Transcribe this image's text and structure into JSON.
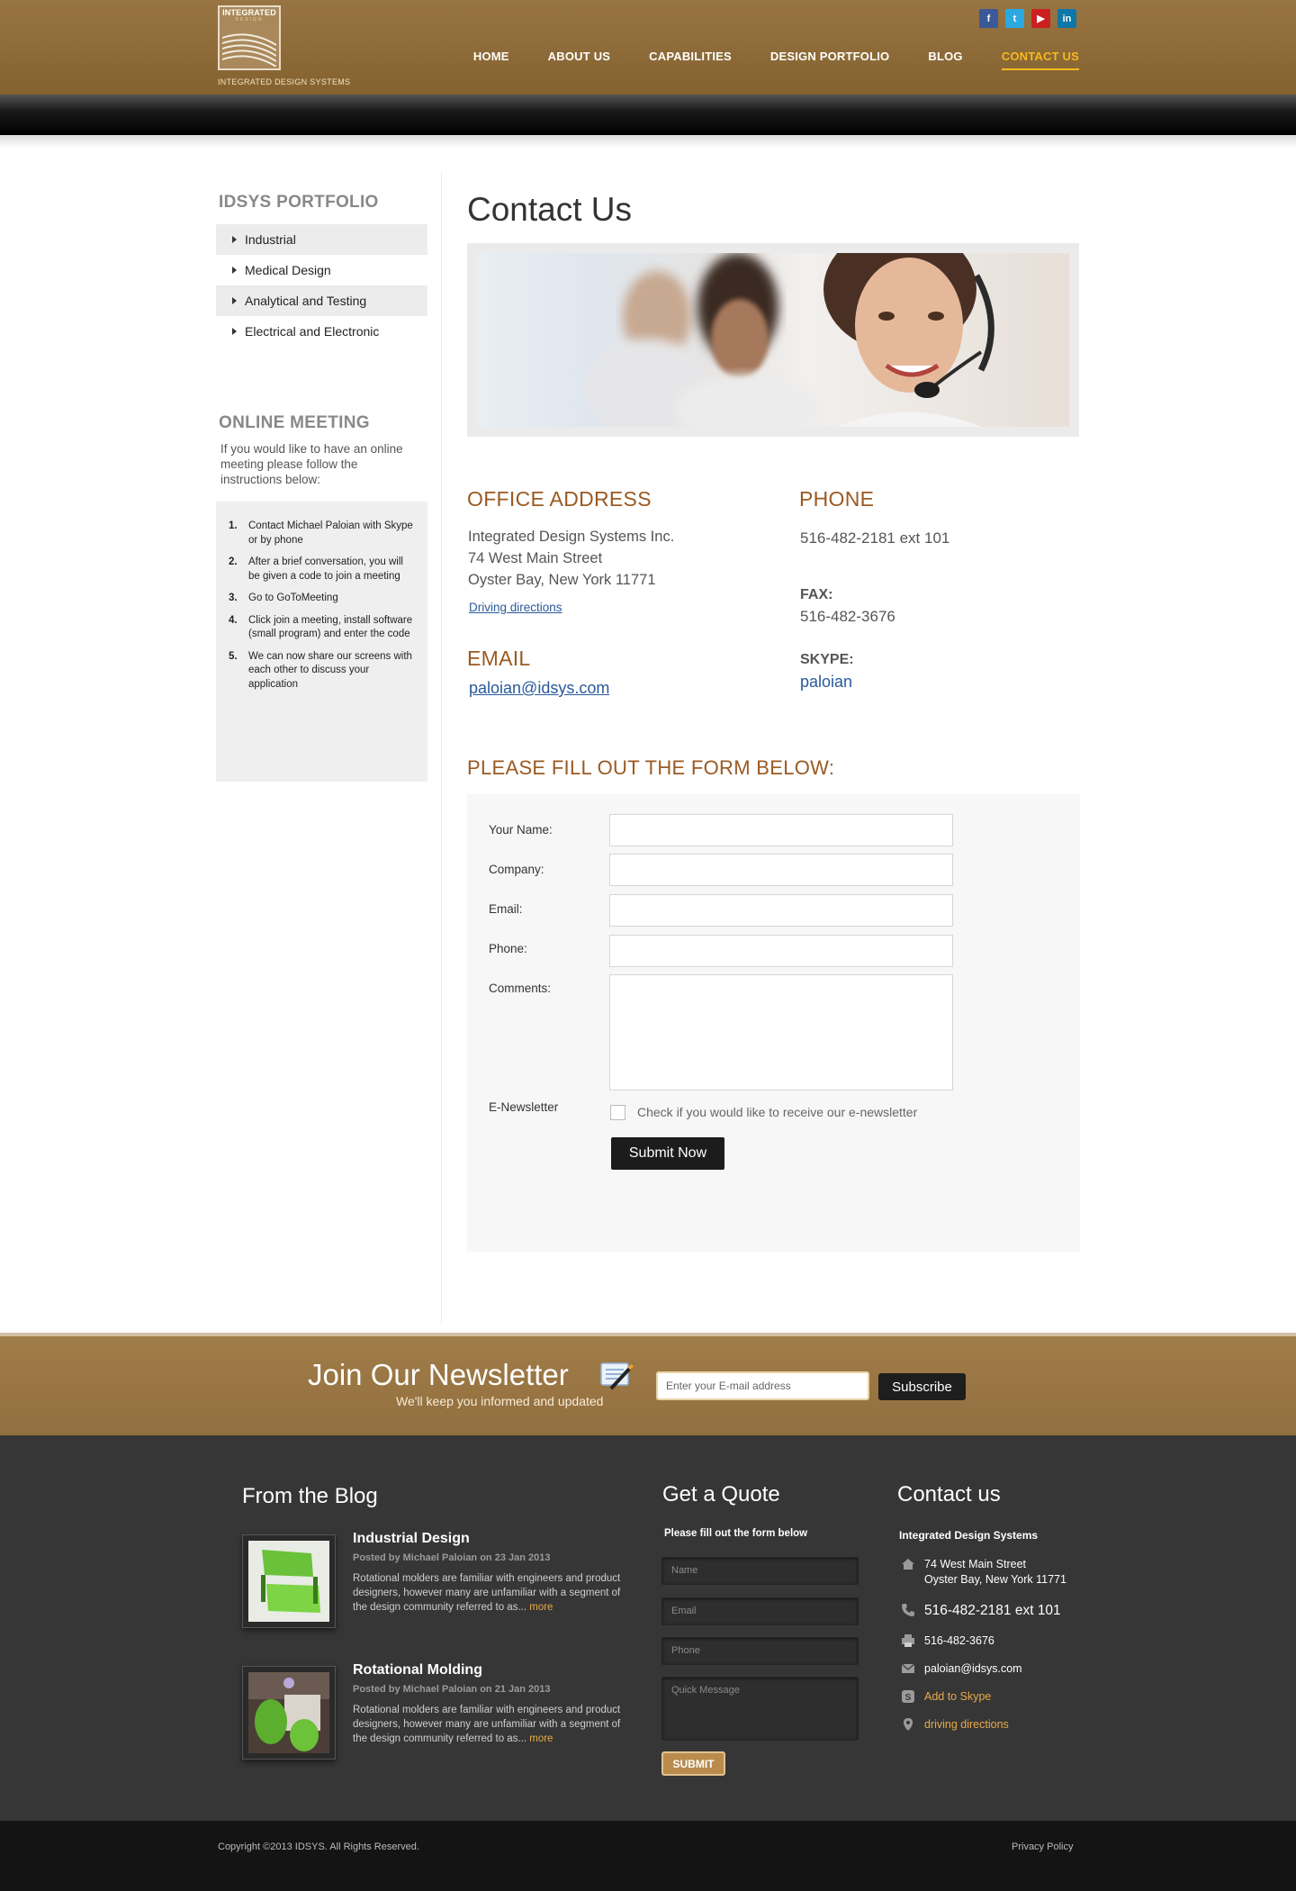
{
  "header": {
    "logo_word": "INTEGRATED",
    "logo_word2": "DESIGN",
    "logo_caption": "INTEGRATED DESIGN SYSTEMS",
    "social": [
      "f",
      "t",
      "▶",
      "in"
    ],
    "nav": [
      "HOME",
      "ABOUT US",
      "CAPABILITIES",
      "DESIGN PORTFOLIO",
      "BLOG",
      "CONTACT US"
    ],
    "active_nav": "CONTACT US"
  },
  "sidebar": {
    "portfolio_title": "IDSYS PORTFOLIO",
    "portfolio_items": [
      "Industrial",
      "Medical Design",
      "Analytical and Testing",
      "Electrical and Electronic"
    ],
    "meeting_title": "ONLINE MEETING",
    "meeting_intro": "If you would like to have an online meeting please follow the instructions below:",
    "steps": [
      "Contact Michael Paloian with Skype or by phone",
      "After a brief conversation, you will be given a code to join a meeting",
      "Go to GoToMeeting",
      "Click join a meeting, install software (small program) and enter the code",
      "We can now share our screens with each other to discuss your application"
    ]
  },
  "main": {
    "title": "Contact Us",
    "office_heading": "OFFICE ADDRESS",
    "office_lines": [
      "Integrated Design Systems Inc.",
      "74 West Main Street",
      "Oyster Bay, New York 11771"
    ],
    "directions_link": "Driving directions",
    "email_heading": "EMAIL",
    "email": "paloian@idsys.com",
    "phone_heading": "PHONE",
    "phone": "516-482-2181 ext 101",
    "fax_label": "FAX:",
    "fax": "516-482-3676",
    "skype_label": "SKYPE:",
    "skype": "paloian",
    "form_heading": "PLEASE FILL OUT THE FORM BELOW:",
    "form": {
      "name_label": "Your Name:",
      "company_label": "Company:",
      "email_label": "Email:",
      "phone_label": "Phone:",
      "comments_label": "Comments:",
      "newsletter_label": "E-Newsletter",
      "newsletter_check": "Check if you would like to receive our e-newsletter",
      "submit": "Submit Now"
    }
  },
  "newsletter": {
    "title": "Join Our Newsletter",
    "subtitle": "We'll keep you informed and updated",
    "placeholder": "Enter your E-mail address",
    "button": "Subscribe"
  },
  "footer": {
    "blog_heading": "From the Blog",
    "posts": [
      {
        "title": "Industrial Design",
        "meta": "Posted by Michael Paloian on 23 Jan 2013",
        "text": "Rotational molders are familiar with engineers and product designers, however many are unfamiliar with a segment of the design community referred to as...",
        "more": "more"
      },
      {
        "title": "Rotational Molding",
        "meta": "Posted by Michael Paloian on 21 Jan 2013",
        "text": "Rotational molders are familiar with engineers and product designers, however many are unfamiliar with a segment of the design community referred to as...",
        "more": "more"
      }
    ],
    "quote_heading": "Get a Quote",
    "quote_sub": "Please fill out the form below",
    "quote_fields": [
      "Name",
      "Email",
      "Phone",
      "Quick Message"
    ],
    "quote_submit": "SUBMIT",
    "contact_heading": "Contact us",
    "contact_name": "Integrated Design Systems",
    "contact_address_1": "74 West Main Street",
    "contact_address_2": "Oyster Bay, New York 11771",
    "contact_phone": "516-482-2181  ext 101",
    "contact_fax": "516-482-3676",
    "contact_email": "paloian@idsys.com",
    "contact_skype": "Add to Skype",
    "contact_directions": "driving directions",
    "copyright": "Copyright ©2013 IDSYS. All Rights Reserved.",
    "privacy": "Privacy Policy"
  },
  "colors": {
    "header_brown": "#8d6a3a",
    "accent_orange": "#f7b81f",
    "heading_rust": "#9a5a22",
    "link_blue": "#2a5a9a",
    "footer_dark": "#363636"
  }
}
